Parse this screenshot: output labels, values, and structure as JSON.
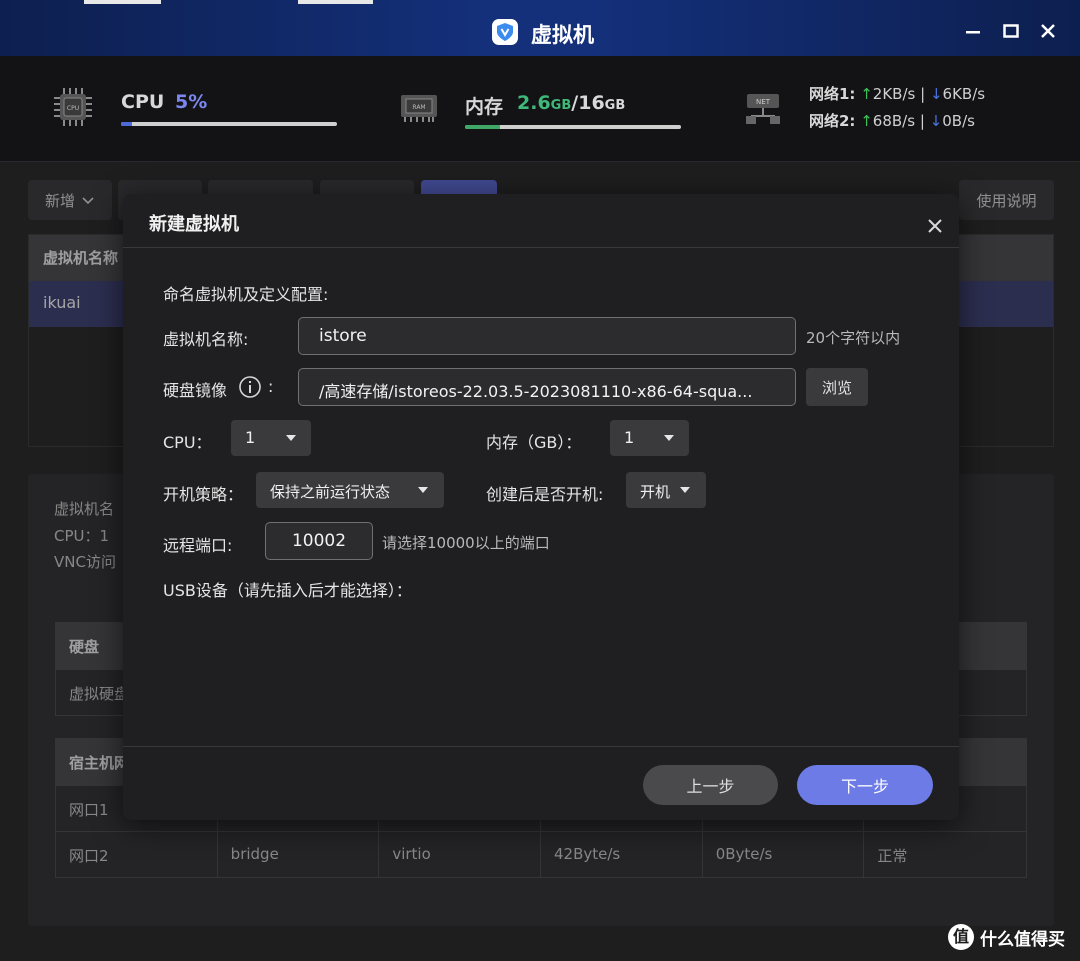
{
  "window": {
    "title": "虚拟机"
  },
  "stats": {
    "cpu_label": "CPU",
    "cpu_value": "5%",
    "cpu_usage": 0.05,
    "mem_label": "内存",
    "mem_used": "2.6",
    "mem_used_unit": "GB",
    "mem_sep": "/",
    "mem_total": "16",
    "mem_total_unit": "GB",
    "mem_usage": 0.16,
    "net1": {
      "label": "网络1:",
      "up": "2KB/s",
      "sep": "|",
      "down": "6KB/s"
    },
    "net2": {
      "label": "网络2:",
      "up": "68B/s",
      "sep": "|",
      "down": "0B/s"
    },
    "up_arrow": "↑",
    "down_arrow": "↓",
    "cpu_chip_text": "CPU",
    "ram_chip_text": "RAM",
    "net_chip_text": "NET"
  },
  "toolbar": {
    "new_label": "新增",
    "help_label": "使用说明"
  },
  "vm_table": {
    "header": "虚拟机名称",
    "rows": [
      "ikuai"
    ]
  },
  "details": {
    "name_prefix": "虚拟机名",
    "cpu_text": "CPU：1",
    "vnc_text": "VNC访问",
    "disk_header": "硬盘",
    "disk_row": "虚拟硬盘",
    "host_header": "宿主机网",
    "net_rows": [
      [
        "网口1",
        "",
        "",
        "",
        "",
        ""
      ],
      [
        "网口2",
        "bridge",
        "virtio",
        "42Byte/s",
        "0Byte/s",
        "正常"
      ]
    ]
  },
  "modal": {
    "title": "新建虚拟机",
    "intro": "命名虚拟机及定义配置:",
    "name_label": "虚拟机名称:",
    "name_value": "istore",
    "name_hint": "20个字符以内",
    "image_label": "硬盘镜像",
    "image_colon": ":",
    "image_value": "/高速存储/istoreos-22.03.5-2023081110-x86-64-squa...",
    "browse_label": "浏览",
    "cpu_label": "CPU：",
    "cpu_value": "1",
    "mem_label": "内存（GB）：",
    "mem_value": "1",
    "boot_policy_label": "开机策略：",
    "boot_policy_value": "保持之前运行状态",
    "boot_after_label": "创建后是否开机:",
    "boot_after_value": "开机",
    "port_label": "远程端口:",
    "port_value": "10002",
    "port_hint": "请选择10000以上的端口",
    "usb_label": "USB设备（请先插入后才能选择）：",
    "prev_label": "上一步",
    "next_label": "下一步"
  },
  "watermark": {
    "icon": "值",
    "text": "什么值得买"
  },
  "colors": {
    "accent": "#6d7be6",
    "cpu_value": "#7b86ef",
    "mem_value": "#3fb87a",
    "net_up": "#3fbf5a",
    "net_down": "#4a74e0"
  }
}
